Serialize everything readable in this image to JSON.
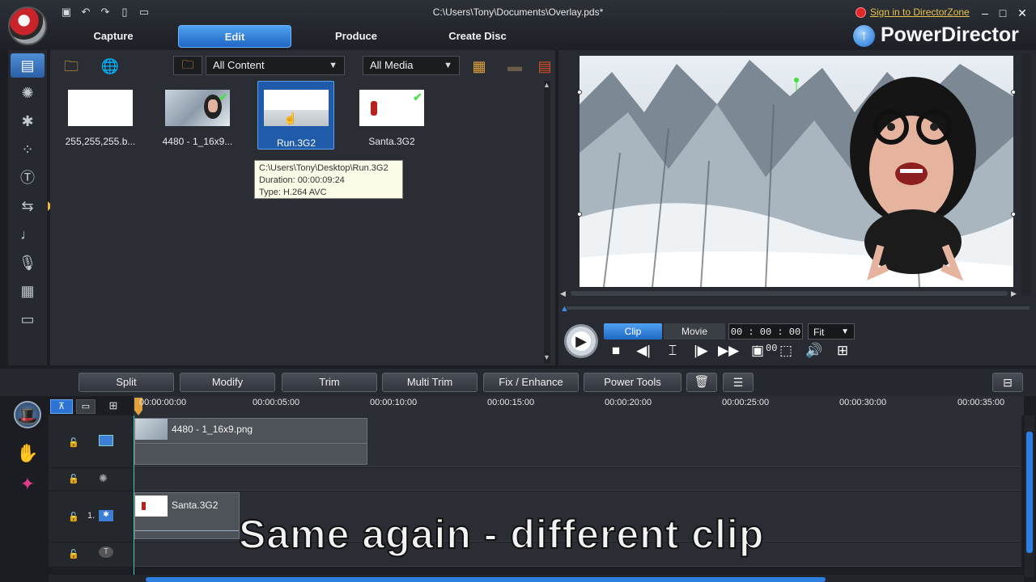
{
  "window": {
    "title": "C:\\Users\\Tony\\Documents\\Overlay.pds*",
    "signin": "Sign in to DirectorZone",
    "brand": "PowerDirector"
  },
  "tabs": [
    {
      "label": "Capture"
    },
    {
      "label": "Edit",
      "active": true
    },
    {
      "label": "Produce"
    },
    {
      "label": "Create Disc"
    }
  ],
  "library": {
    "content_filter": "All Content",
    "media_filter": "All Media",
    "items": [
      {
        "label": "255,255,255.b..."
      },
      {
        "label": "4480 - 1_16x9...",
        "checked": true
      },
      {
        "label": "Run.3G2",
        "selected": true
      },
      {
        "label": "Santa.3G2",
        "checked": true
      }
    ],
    "tooltip": {
      "path": "C:\\Users\\Tony\\Desktop\\Run.3G2",
      "duration": "Duration: 00:00:09:24",
      "type": "Type: H.264 AVC"
    }
  },
  "preview": {
    "mode_clip": "Clip",
    "mode_movie": "Movie",
    "timecode": "00 : 00 : 00 : 00",
    "fit": "Fit"
  },
  "timeline": {
    "buttons": [
      "Split",
      "Modify",
      "Trim",
      "Multi Trim",
      "Fix / Enhance",
      "Power Tools"
    ],
    "ticks": [
      "00:00:00:00",
      "00:00:05:00",
      "00:00:10:00",
      "00:00:15:00",
      "00:00:20:00",
      "00:00:25:00",
      "00:00:30:00",
      "00:00:35:00"
    ],
    "track_number": "1.",
    "clips": [
      {
        "label": "4480 - 1_16x9.png"
      },
      {
        "label": "Santa.3G2"
      }
    ]
  },
  "caption": "Same again - different clip",
  "colors": {
    "accent": "#2b74d6",
    "check": "#4ce04c",
    "signin": "#e9c44b"
  }
}
